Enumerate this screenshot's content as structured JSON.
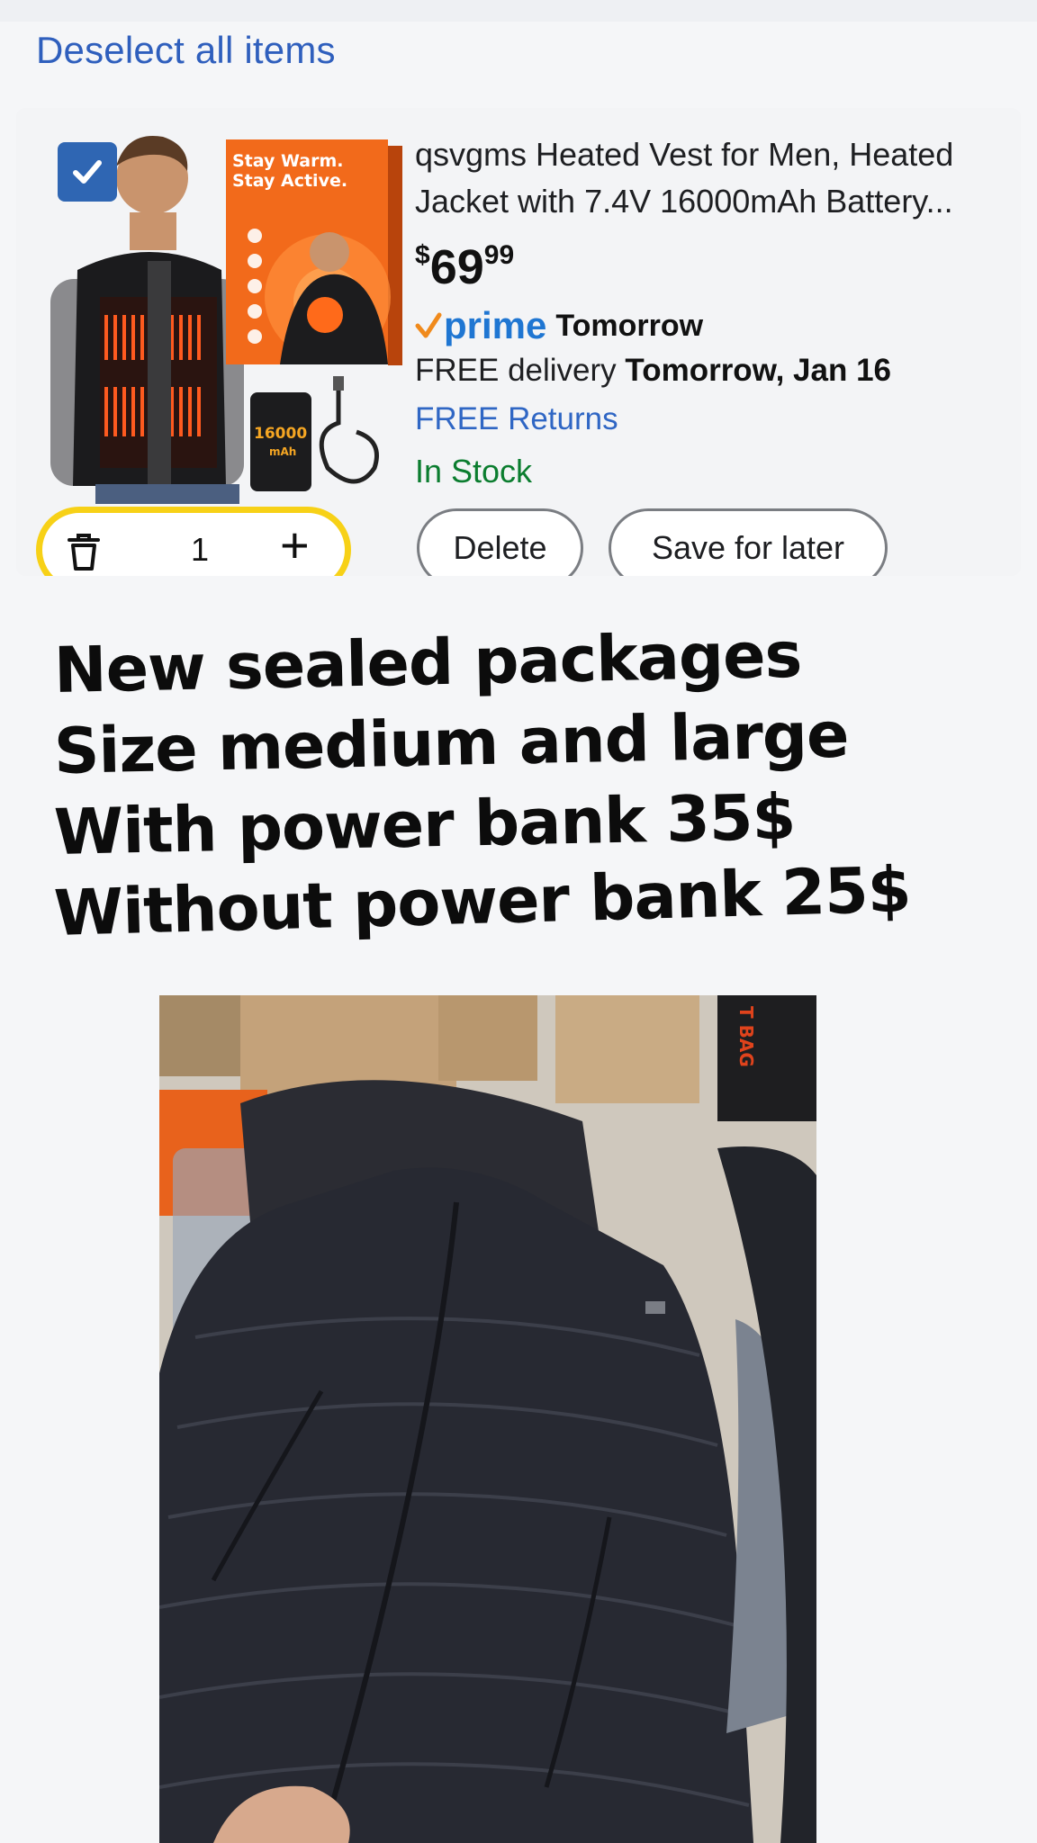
{
  "header": {
    "deselect_label": "Deselect all items"
  },
  "cart_item": {
    "checked": true,
    "image_caption": {
      "line1": "Stay Warm.",
      "line2": "Stay Active.",
      "badge": "16000 mAh"
    },
    "title": "qsvgms Heated Vest for Men, Heated Jacket with 7.4V 16000mAh Battery...",
    "price": {
      "symbol": "$",
      "whole": "69",
      "cents": "99"
    },
    "prime": {
      "label": "prime",
      "when": "Tomorrow"
    },
    "delivery": {
      "prefix": "FREE delivery",
      "date": "Tomorrow, Jan 16"
    },
    "returns": "FREE Returns",
    "stock": "In Stock",
    "quantity": "1",
    "delete_label": "Delete",
    "save_label": "Save for later"
  },
  "post_caption": {
    "line1": "New sealed packages",
    "line2": "Size medium and large",
    "line3": "With power bank 35$",
    "line4": "Without power bank 25$"
  },
  "photo": {
    "box_text": "T BAG"
  },
  "colors": {
    "link_blue": "#2f5fbd",
    "in_stock_green": "#0b7d2f",
    "prime_blue": "#1f76d2",
    "qty_outline_yellow": "#f7d117",
    "checkbox_blue": "#2f66b3"
  }
}
